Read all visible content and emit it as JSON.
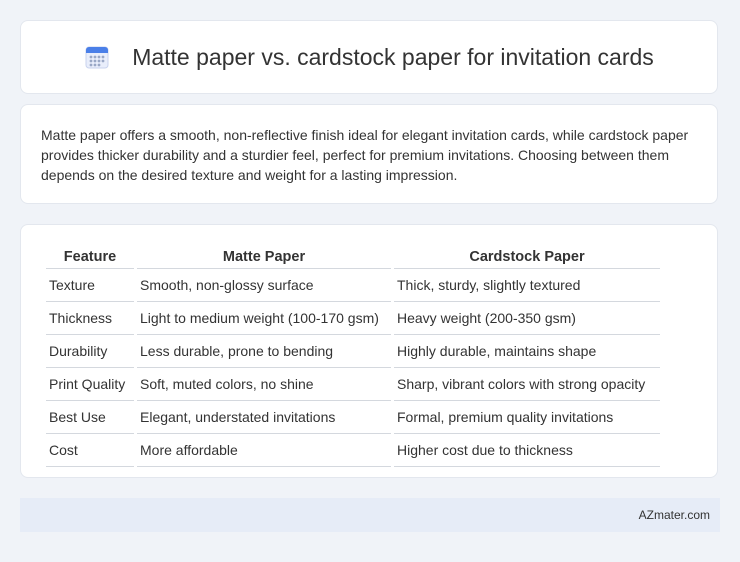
{
  "header": {
    "title": "Matte paper vs. cardstock paper for invitation cards",
    "icon": "calendar-icon"
  },
  "summary": {
    "text": "Matte paper offers a smooth, non-reflective finish ideal for elegant invitation cards, while cardstock paper provides thicker durability and a sturdier feel, perfect for premium invitations. Choosing between them depends on the desired texture and weight for a lasting impression."
  },
  "table": {
    "headers": [
      "Feature",
      "Matte Paper",
      "Cardstock Paper"
    ],
    "rows": [
      [
        "Texture",
        "Smooth, non-glossy surface",
        "Thick, sturdy, slightly textured"
      ],
      [
        "Thickness",
        "Light to medium weight (100-170 gsm)",
        "Heavy weight (200-350 gsm)"
      ],
      [
        "Durability",
        "Less durable, prone to bending",
        "Highly durable, maintains shape"
      ],
      [
        "Print Quality",
        "Soft, muted colors, no shine",
        "Sharp, vibrant colors with strong opacity"
      ],
      [
        "Best Use",
        "Elegant, understated invitations",
        "Formal, premium quality invitations"
      ],
      [
        "Cost",
        "More affordable",
        "Higher cost due to thickness"
      ]
    ]
  },
  "footer": {
    "brand": "AZmater.com"
  },
  "colors": {
    "background": "#f0f3f8",
    "card": "#ffffff",
    "footer_bg": "#e6ecf7",
    "icon_accent": "#4a7fe8"
  }
}
